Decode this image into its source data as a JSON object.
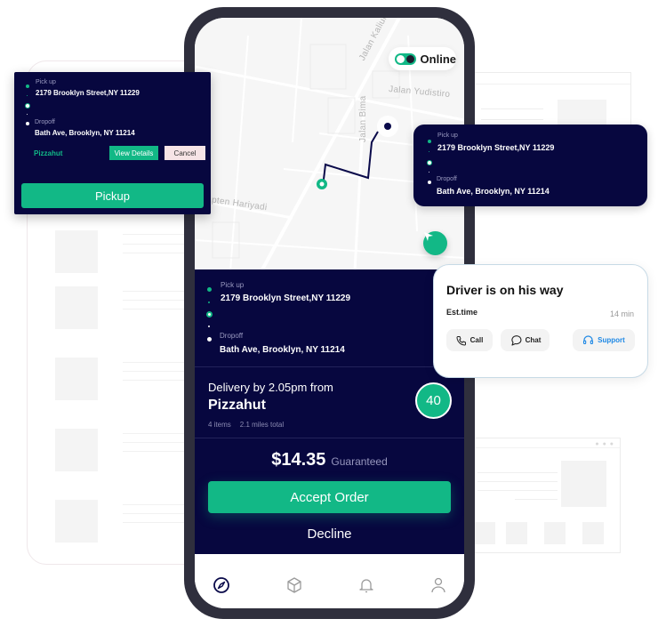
{
  "map": {
    "streets": [
      "Jalan Kaliurang",
      "Jalan Yudistiro",
      "Jalan Bima",
      "Kapten Hariyadi"
    ],
    "online_toggle": {
      "label": "Online",
      "on": true
    }
  },
  "order": {
    "pickup_label": "Pick up",
    "pickup_address": "2179  Brooklyn Street,NY 11229",
    "dropoff_label": "Dropoff",
    "dropoff_address": "Bath Ave, Brooklyn, NY 11214",
    "delivery_by": "Delivery by 2.05pm from",
    "store": "Pizzahut",
    "items": "4 items",
    "distance": "2.1 miles total",
    "eta": "40",
    "price": "$14.35",
    "price_note": "Guaranteed",
    "accept_label": "Accept Order",
    "decline_label": "Decline"
  },
  "tabbar": {
    "items": [
      {
        "icon": "compass-icon",
        "active": true
      },
      {
        "icon": "box-icon",
        "active": false
      },
      {
        "icon": "bell-icon",
        "active": false
      },
      {
        "icon": "user-icon",
        "active": false
      }
    ]
  },
  "left_card": {
    "pickup_label": "Pick up",
    "pickup_address": "2179  Brooklyn Street,NY 11229",
    "dropoff_label": "Dropoff",
    "dropoff_address": "Bath Ave, Brooklyn, NY 11214",
    "store": "Pizzahut",
    "view_details_label": "View Details",
    "cancel_label": "Cancel",
    "pickup_button_label": "Pickup"
  },
  "right_card": {
    "pickup_label": "Pick up",
    "pickup_address": "2179  Brooklyn Street,NY 11229",
    "dropoff_label": "Dropoff",
    "dropoff_address": "Bath Ave, Brooklyn, NY 11214"
  },
  "driver_card": {
    "title": "Driver is on his way",
    "est_label": "Est.time",
    "est_value": "14 min",
    "call_label": "Call",
    "chat_label": "Chat",
    "support_label": "Support"
  },
  "colors": {
    "navy": "#07073f",
    "accent": "#12b886",
    "support": "#1e88e5",
    "phone_frame": "#2f2f3d"
  }
}
